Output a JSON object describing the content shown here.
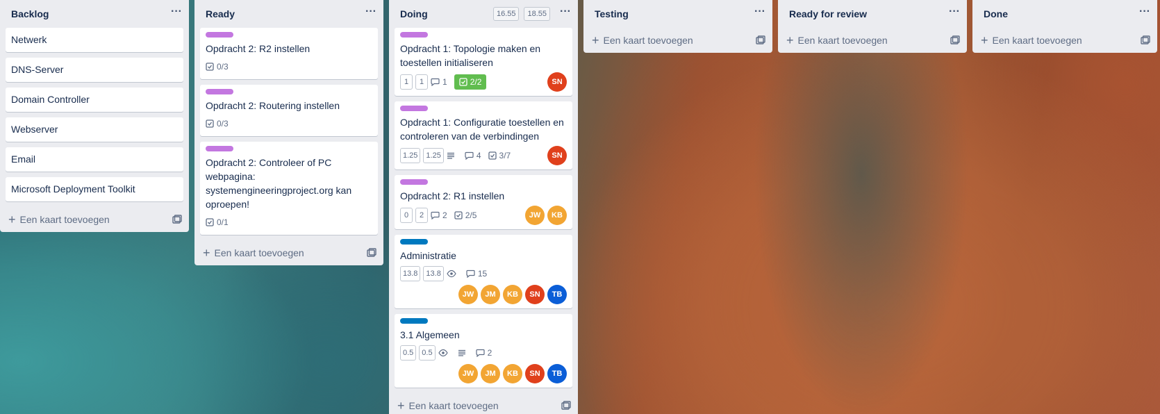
{
  "lists": {
    "backlog": {
      "title": "Backlog",
      "cards": [
        "Netwerk",
        "DNS-Server",
        "Domain Controller",
        "Webserver",
        "Email",
        "Microsoft Deployment Toolkit"
      ],
      "add_label": "Een kaart toevoegen"
    },
    "ready": {
      "title": "Ready",
      "cards": [
        {
          "title": "Opdracht 2: R2 instellen",
          "checklist": "0/3",
          "label_color": "#c377e0"
        },
        {
          "title": "Opdracht 2: Routering instellen",
          "checklist": "0/3",
          "label_color": "#c377e0"
        },
        {
          "title": "Opdracht 2: Controleer of PC webpagina: systemengineeringproject.org kan oproepen!",
          "checklist": "0/1",
          "label_color": "#c377e0"
        }
      ],
      "add_label": "Een kaart toevoegen"
    },
    "doing": {
      "title": "Doing",
      "estimates": [
        "16.55",
        "18.55"
      ],
      "cards": [
        {
          "title": "Opdracht 1: Topologie maken en toestellen initialiseren",
          "est1": "1",
          "est2": "1",
          "comments": "1",
          "checklist": "2/2",
          "label_color": "#c377e0",
          "members": [
            "SN"
          ]
        },
        {
          "title": "Opdracht 1: Configuratie toestellen en controleren van de verbindingen",
          "est1": "1.25",
          "est2": "1.25",
          "comments": "4",
          "checklist": "3/7",
          "label_color": "#c377e0",
          "members": [
            "SN"
          ]
        },
        {
          "title": "Opdracht 2: R1 instellen",
          "est1": "0",
          "est2": "2",
          "comments": "2",
          "checklist": "2/5",
          "label_color": "#c377e0",
          "members": [
            "JW",
            "KB"
          ]
        },
        {
          "title": "Administratie",
          "est1": "13.8",
          "est2": "13.8",
          "comments": "15",
          "label_color": "#0079bf",
          "members": [
            "JW",
            "JM",
            "KB",
            "SN",
            "TB"
          ]
        },
        {
          "title": "3.1 Algemeen",
          "est1": "0.5",
          "est2": "0.5",
          "comments": "2",
          "label_color": "#0079bf",
          "members": [
            "JW",
            "JM",
            "KB",
            "SN",
            "TB"
          ]
        }
      ],
      "add_label": "Een kaart toevoegen"
    },
    "testing": {
      "title": "Testing",
      "add_label": "Een kaart toevoegen"
    },
    "ready_for_review": {
      "title": "Ready for review",
      "add_label": "Een kaart toevoegen"
    },
    "done": {
      "title": "Done",
      "add_label": "Een kaart toevoegen"
    }
  },
  "colors": {
    "checklist_complete": "#61bd4f",
    "avatar_orange": "#f2a533",
    "avatar_red": "#e0401c",
    "avatar_blue": "#0b5ed7",
    "list_bg": "#ebecf0"
  },
  "icons": {
    "list_menu": "ellipsis-icon",
    "add_card": "plus-icon",
    "template": "card-template-icon",
    "checklist": "checklist-icon",
    "comment": "comment-icon",
    "watch": "eye-icon",
    "description": "description-icon"
  }
}
